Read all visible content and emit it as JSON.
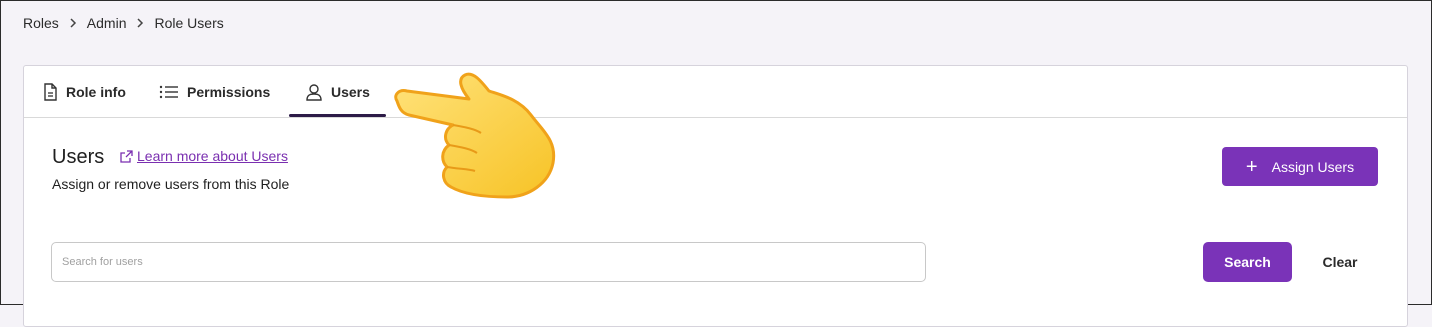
{
  "breadcrumb": {
    "items": [
      "Roles",
      "Admin",
      "Role Users"
    ]
  },
  "tabs": [
    {
      "label": "Role info",
      "icon": "document-icon"
    },
    {
      "label": "Permissions",
      "icon": "list-icon"
    },
    {
      "label": "Users",
      "icon": "user-icon",
      "active": true
    }
  ],
  "section": {
    "title": "Users",
    "learn_more": "Learn more about Users",
    "subtitle": "Assign or remove users from this Role"
  },
  "assign_button": {
    "label": "Assign Users",
    "icon": "plus-icon"
  },
  "search": {
    "placeholder": "Search for users",
    "button_label": "Search",
    "clear_label": "Clear"
  },
  "colors": {
    "accent": "#7a33b8",
    "tab_underline": "#2c1b47",
    "link": "#7a2fb0"
  }
}
